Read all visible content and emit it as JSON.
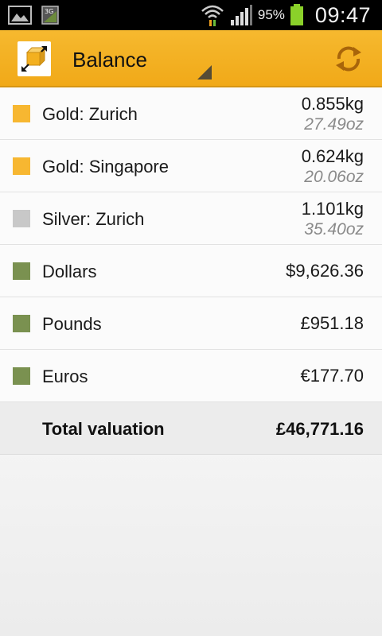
{
  "status_bar": {
    "battery_pct": "95%",
    "time": "09:47",
    "network": "3G"
  },
  "app_bar": {
    "title": "Balance",
    "brand_color": "#f3b020"
  },
  "items": [
    {
      "label": "Gold: Zurich",
      "value": "0.855kg",
      "sub": "27.49oz",
      "color": "#f7b731"
    },
    {
      "label": "Gold: Singapore",
      "value": "0.624kg",
      "sub": "20.06oz",
      "color": "#f7b731"
    },
    {
      "label": "Silver: Zurich",
      "value": "1.101kg",
      "sub": "35.40oz",
      "color": "#c8c8c8"
    },
    {
      "label": "Dollars",
      "value": "$9,626.36",
      "color": "#7a9150"
    },
    {
      "label": "Pounds",
      "value": "£951.18",
      "color": "#7a9150"
    },
    {
      "label": "Euros",
      "value": "€177.70",
      "color": "#7a9150"
    }
  ],
  "total": {
    "label": "Total valuation",
    "value": "£46,771.16"
  }
}
